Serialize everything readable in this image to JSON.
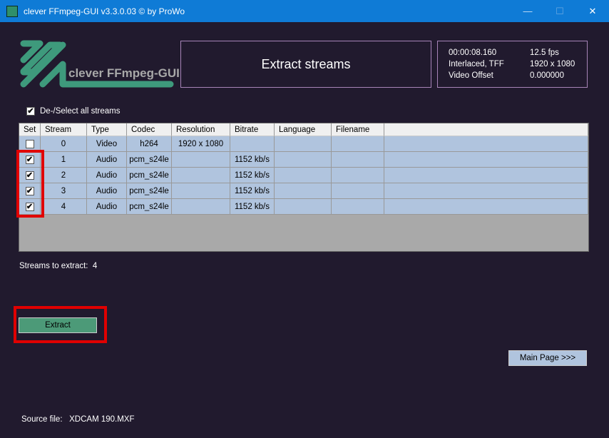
{
  "window": {
    "title": "clever FFmpeg-GUI v3.3.0.03    © by ProWo",
    "minimize": "—",
    "maximize": "☐",
    "close": "✕"
  },
  "logo": {
    "text": "clever FFmpeg-GUI"
  },
  "header": {
    "title": "Extract streams"
  },
  "info": {
    "duration": "00:00:08.160",
    "fps": "12.5 fps",
    "scan": "Interlaced, TFF",
    "resolution": "1920 x 1080",
    "offset_label": "Video Offset",
    "offset_value": "0.000000"
  },
  "select_all": {
    "label": "De-/Select all streams",
    "checked": true
  },
  "table": {
    "columns": [
      "Set",
      "Stream",
      "Type",
      "Codec",
      "Resolution",
      "Bitrate",
      "Language",
      "Filename"
    ],
    "rows": [
      {
        "set": false,
        "stream": "0",
        "type": "Video",
        "codec": "h264",
        "resolution": "1920 x 1080",
        "bitrate": "",
        "language": "",
        "filename": ""
      },
      {
        "set": true,
        "stream": "1",
        "type": "Audio",
        "codec": "pcm_s24le",
        "resolution": "",
        "bitrate": "1152 kb/s",
        "language": "",
        "filename": ""
      },
      {
        "set": true,
        "stream": "2",
        "type": "Audio",
        "codec": "pcm_s24le",
        "resolution": "",
        "bitrate": "1152 kb/s",
        "language": "",
        "filename": ""
      },
      {
        "set": true,
        "stream": "3",
        "type": "Audio",
        "codec": "pcm_s24le",
        "resolution": "",
        "bitrate": "1152 kb/s",
        "language": "",
        "filename": ""
      },
      {
        "set": true,
        "stream": "4",
        "type": "Audio",
        "codec": "pcm_s24le",
        "resolution": "",
        "bitrate": "1152 kb/s",
        "language": "",
        "filename": ""
      }
    ]
  },
  "status": {
    "label": "Streams to extract:",
    "count": "4"
  },
  "buttons": {
    "extract": "Extract",
    "main_page": "Main Page >>>"
  },
  "source": {
    "label": "Source file:",
    "value": "XDCAM 190.MXF"
  }
}
